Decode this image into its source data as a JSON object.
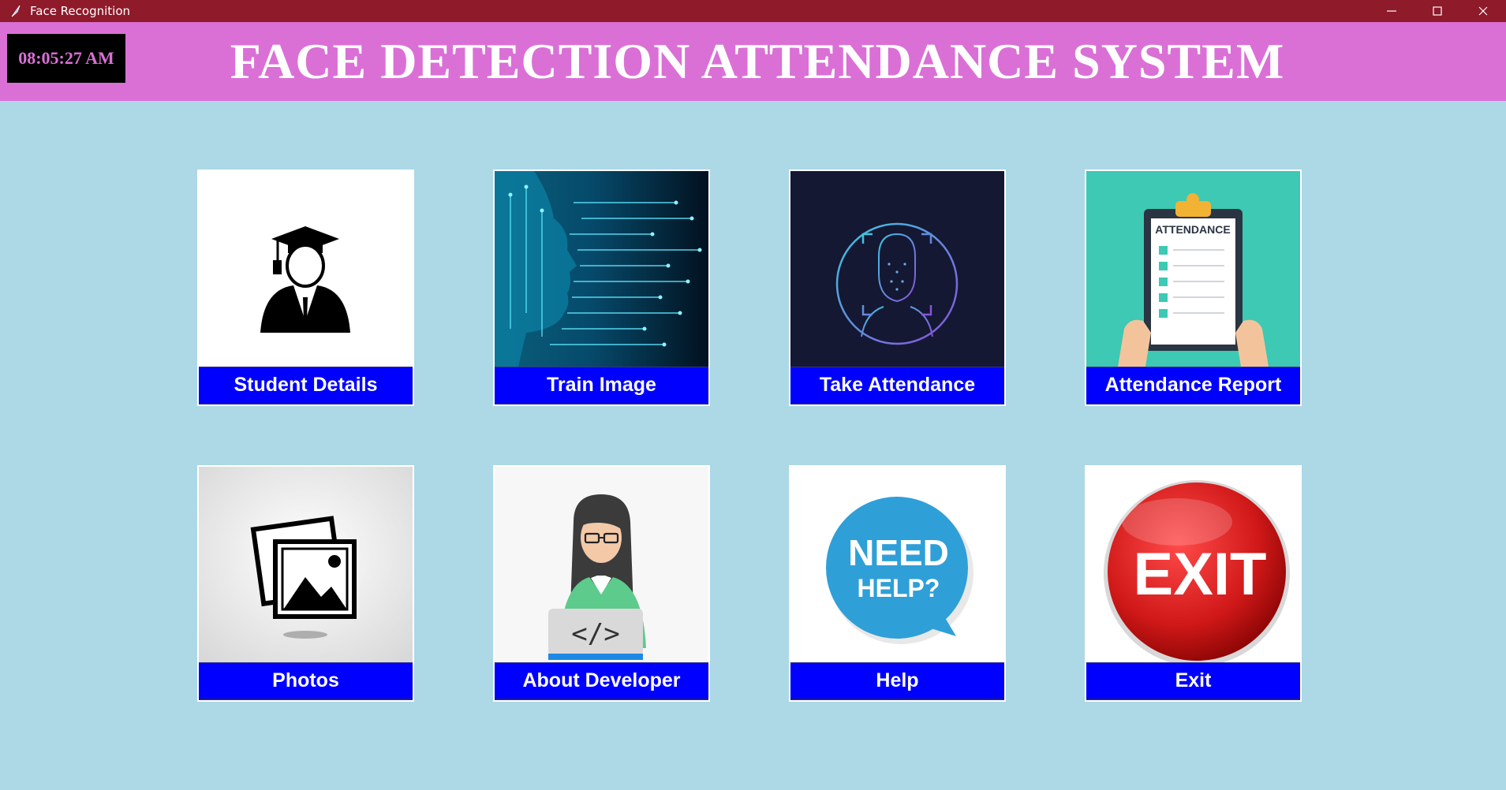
{
  "window": {
    "title": "Face Recognition",
    "controls": [
      "minimize-icon",
      "maximize-icon",
      "close-icon"
    ]
  },
  "header": {
    "clock": "08:05:27 AM",
    "title": "FACE DETECTION ATTENDANCE SYSTEM"
  },
  "colors": {
    "titlebar": "#8e1a2a",
    "header": "#da70d6",
    "background": "#add8e6",
    "button": "#0000ff",
    "clock_bg": "#000000"
  },
  "tiles": [
    {
      "label": "Student Details",
      "icon": "student-graduate-icon"
    },
    {
      "label": "Train Image",
      "icon": "ai-circuit-face-icon"
    },
    {
      "label": "Take Attendance",
      "icon": "face-scan-icon"
    },
    {
      "label": "Attendance Report",
      "icon": "attendance-clipboard-icon",
      "image_text": "ATTENDANCE"
    },
    {
      "label": "Photos",
      "icon": "photos-gallery-icon"
    },
    {
      "label": "About Developer",
      "icon": "developer-avatar-icon",
      "image_text": "</>"
    },
    {
      "label": "Help",
      "icon": "need-help-bubble-icon",
      "image_text_1": "NEED",
      "image_text_2": "HELP?"
    },
    {
      "label": "Exit",
      "icon": "exit-button-icon",
      "image_text": "EXIT"
    }
  ]
}
